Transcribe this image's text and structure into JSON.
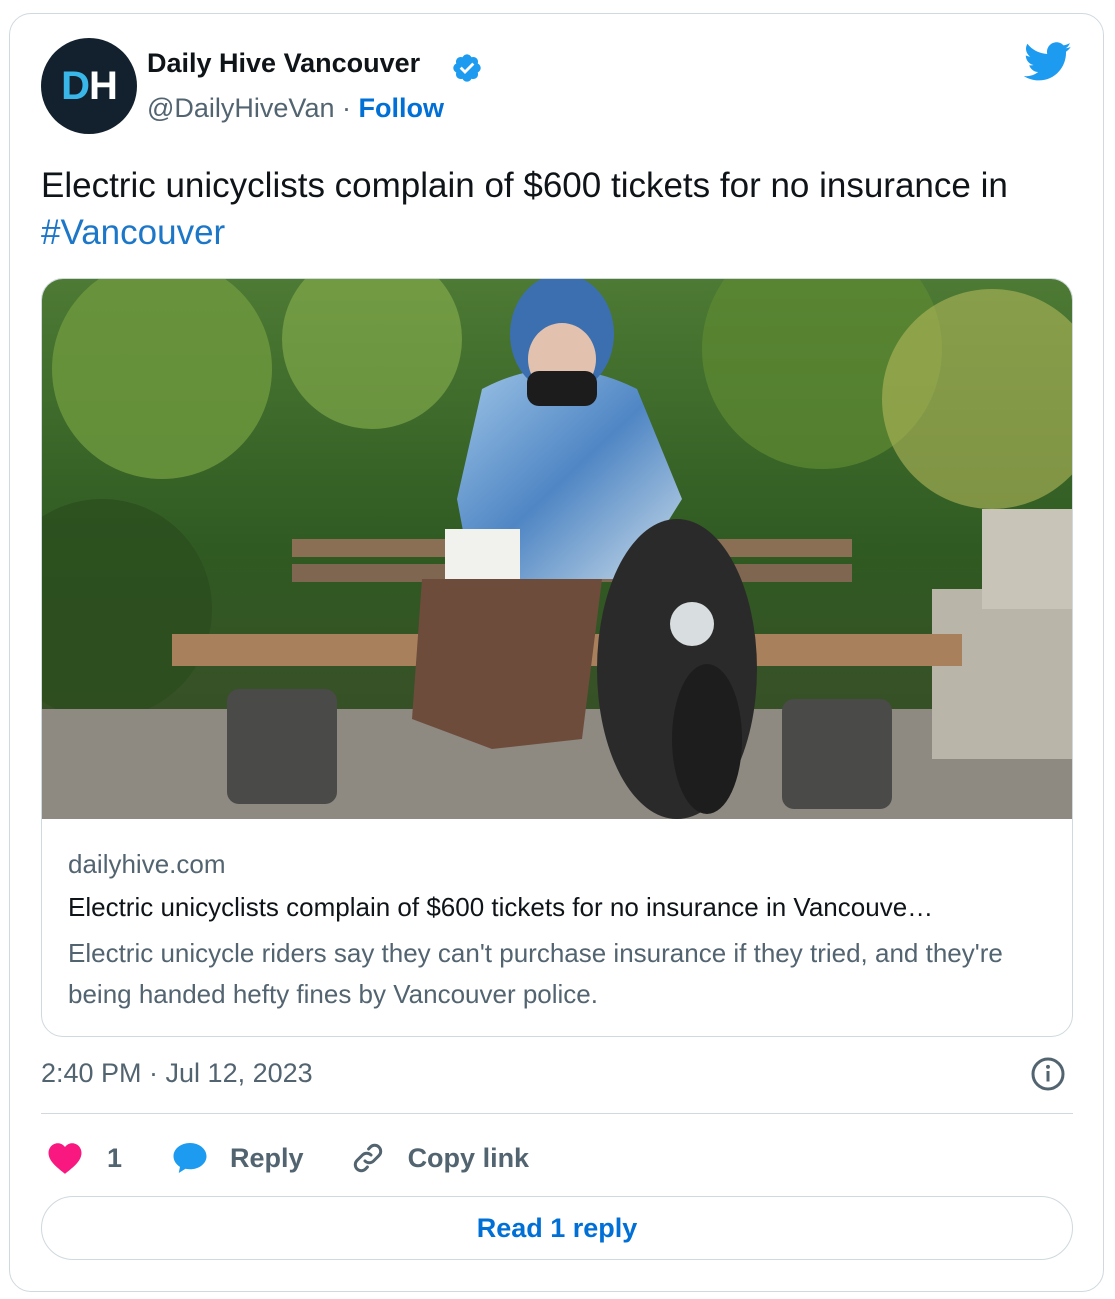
{
  "author": {
    "display_name": "Daily Hive Vancouver",
    "handle": "@DailyHiveVan",
    "separator": "·",
    "follow_label": "Follow",
    "avatar_letter_1": "D",
    "avatar_letter_2": "H",
    "verified_icon": "verified-badge-icon",
    "platform_icon": "twitter-bird-icon"
  },
  "tweet": {
    "text_before": "Electric unicyclists complain of $600 tickets for no insurance in ",
    "hashtag": "#Vancouver"
  },
  "link_card": {
    "domain": "dailyhive.com",
    "title": "Electric unicyclists complain of $600 tickets for no insurance in Vancouve…",
    "description": "Electric unicycle riders say they can't purchase insurance if they tried, and they're being handed hefty fines by Vancouver police."
  },
  "meta": {
    "timestamp": "2:40 PM · Jul 12, 2023"
  },
  "actions": {
    "like_count": "1",
    "reply_label": "Reply",
    "copy_link_label": "Copy link"
  },
  "read_replies_label": "Read 1 reply",
  "colors": {
    "accent": "#006fd6",
    "twitter_blue": "#1d9bf0",
    "like_red": "#f91880",
    "muted_text": "#536471",
    "border": "#cfd9de"
  }
}
